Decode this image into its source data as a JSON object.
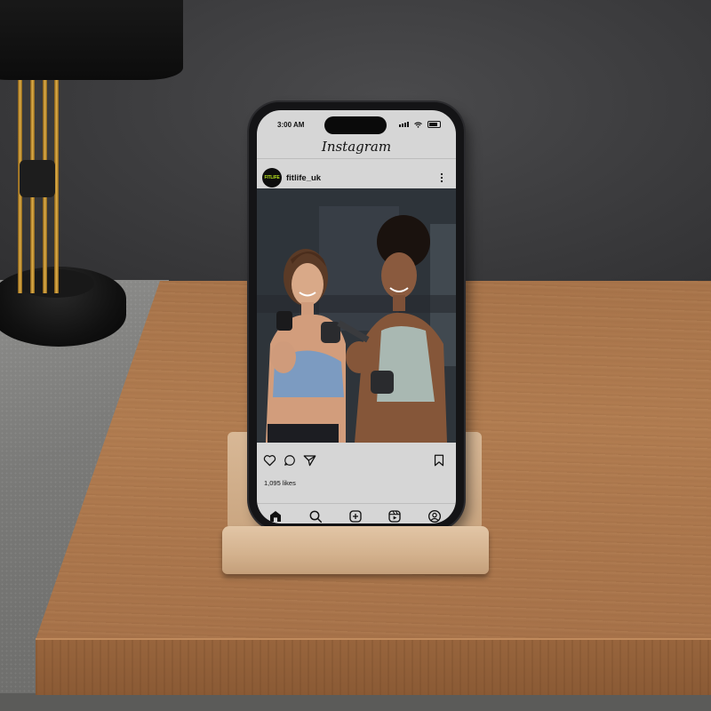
{
  "status_bar": {
    "time": "3:00 AM"
  },
  "app": {
    "title": "Instagram"
  },
  "post": {
    "username": "fitlife_uk",
    "avatar_text": "FITLIFE",
    "likes": "1,095 likes"
  },
  "actions": [
    "heart-icon",
    "comment-icon",
    "share-icon",
    "bookmark-icon"
  ],
  "bottom_nav": [
    "home-icon",
    "search-icon",
    "create-icon",
    "reels-icon",
    "profile-icon"
  ],
  "colors": {
    "avatar_accent": "#b6e21d",
    "screen_bg": "#d6d6d6"
  }
}
